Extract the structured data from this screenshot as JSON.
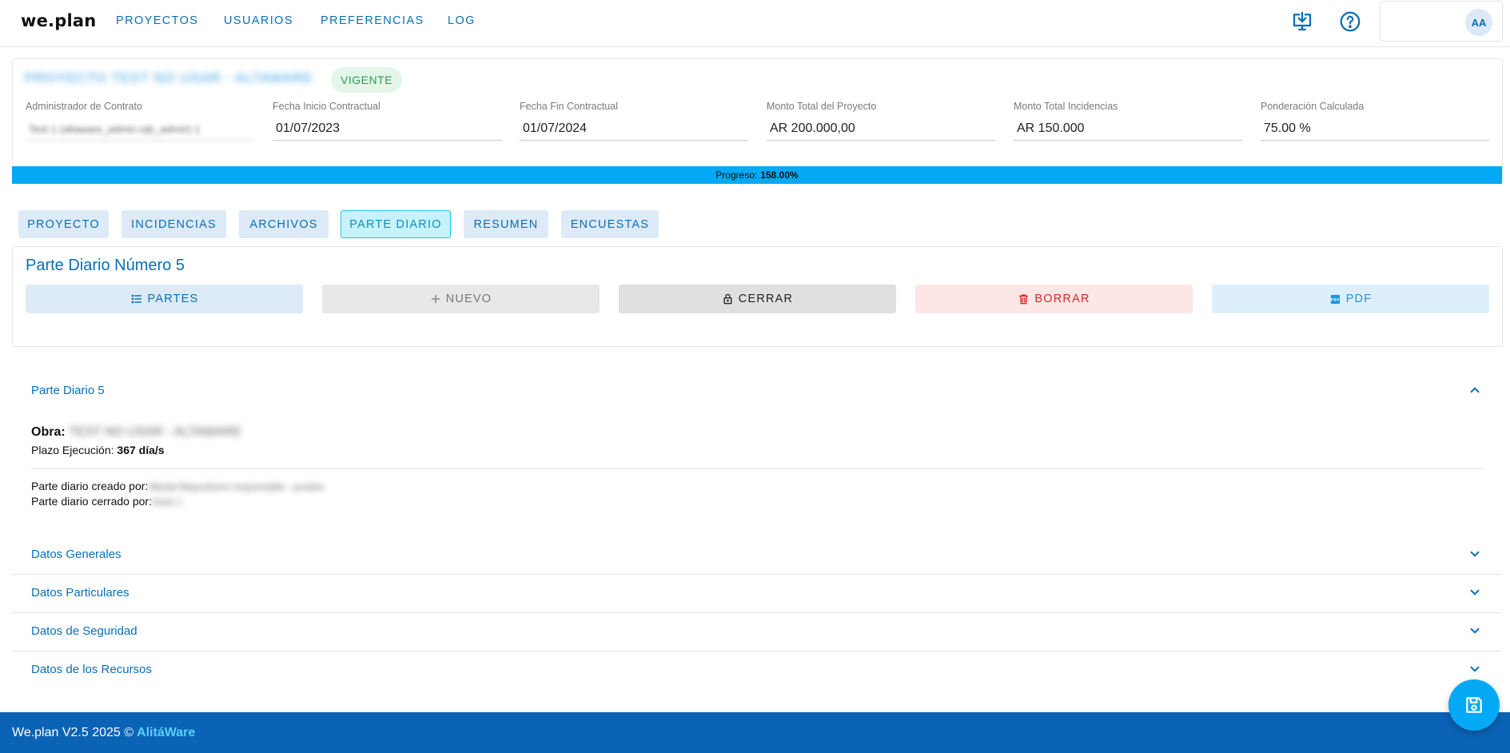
{
  "app": {
    "logo": "we.plan"
  },
  "nav": {
    "items": [
      {
        "label": "PROYECTOS"
      },
      {
        "label": "USUARIOS"
      },
      {
        "label": "PREFERENCIAS"
      },
      {
        "label": "LOG"
      }
    ],
    "icons": [
      "download-desktop-icon",
      "help-icon"
    ],
    "user_initials": "AA"
  },
  "project": {
    "title": "PROYECTO TEST NO USAR - ALTAWARE",
    "status": "VIGENTE",
    "fields": [
      {
        "label": "Administrador de Contrato",
        "value": "Test 1 (altaware_admin.rqb_admin) 1"
      },
      {
        "label": "Fecha Inicio Contractual",
        "value": "01/07/2023"
      },
      {
        "label": "Fecha Fin Contractual",
        "value": "01/07/2024"
      },
      {
        "label": "Monto Total del Proyecto",
        "value": "AR 200.000,00"
      },
      {
        "label": "Monto Total Incidencias",
        "value": "AR 150.000"
      },
      {
        "label": "Ponderación Calculada",
        "value": "75.00 %"
      }
    ],
    "progress_label": "Progreso:",
    "progress_value": "158.00%"
  },
  "tabs": [
    {
      "label": "PROYECTO"
    },
    {
      "label": "INCIDENCIAS"
    },
    {
      "label": "ARCHIVOS"
    },
    {
      "label": "PARTE DIARIO",
      "active": true
    },
    {
      "label": "RESUMEN"
    },
    {
      "label": "ENCUESTAS"
    }
  ],
  "parte_diario": {
    "title": "Parte Diario Número 5",
    "actions": {
      "partes": "PARTES",
      "nuevo": "NUEVO",
      "cerrar": "CERRAR",
      "borrar": "BORRAR",
      "pdf": "PDF"
    }
  },
  "details": {
    "header": "Parte Diario  5",
    "obra_label": "Obra:",
    "obra_value": "TEST NO USAR - ALTAWARE",
    "plazo_label": "Plazo Ejecución:",
    "plazo_value": "367 día/s",
    "creado_label": "Parte diario creado por:",
    "creado_value": "Nikolai Mayordomo responsable - prueba",
    "cerrado_label": "Parte diario cerrado por:",
    "cerrado_value": "Gisel J"
  },
  "sections": [
    {
      "label": "Datos Generales"
    },
    {
      "label": "Datos Particulares"
    },
    {
      "label": "Datos de Seguridad"
    },
    {
      "label": "Datos de los Recursos"
    }
  ],
  "footer": {
    "text": "We.plan V2.5 2025 ©",
    "brand": "AlitáWare"
  },
  "colors": {
    "primary": "#0a6fb5",
    "progress": "#03a9f4",
    "footer": "#0b63b5",
    "danger": "#d62828",
    "success": "#2a9d4e"
  }
}
